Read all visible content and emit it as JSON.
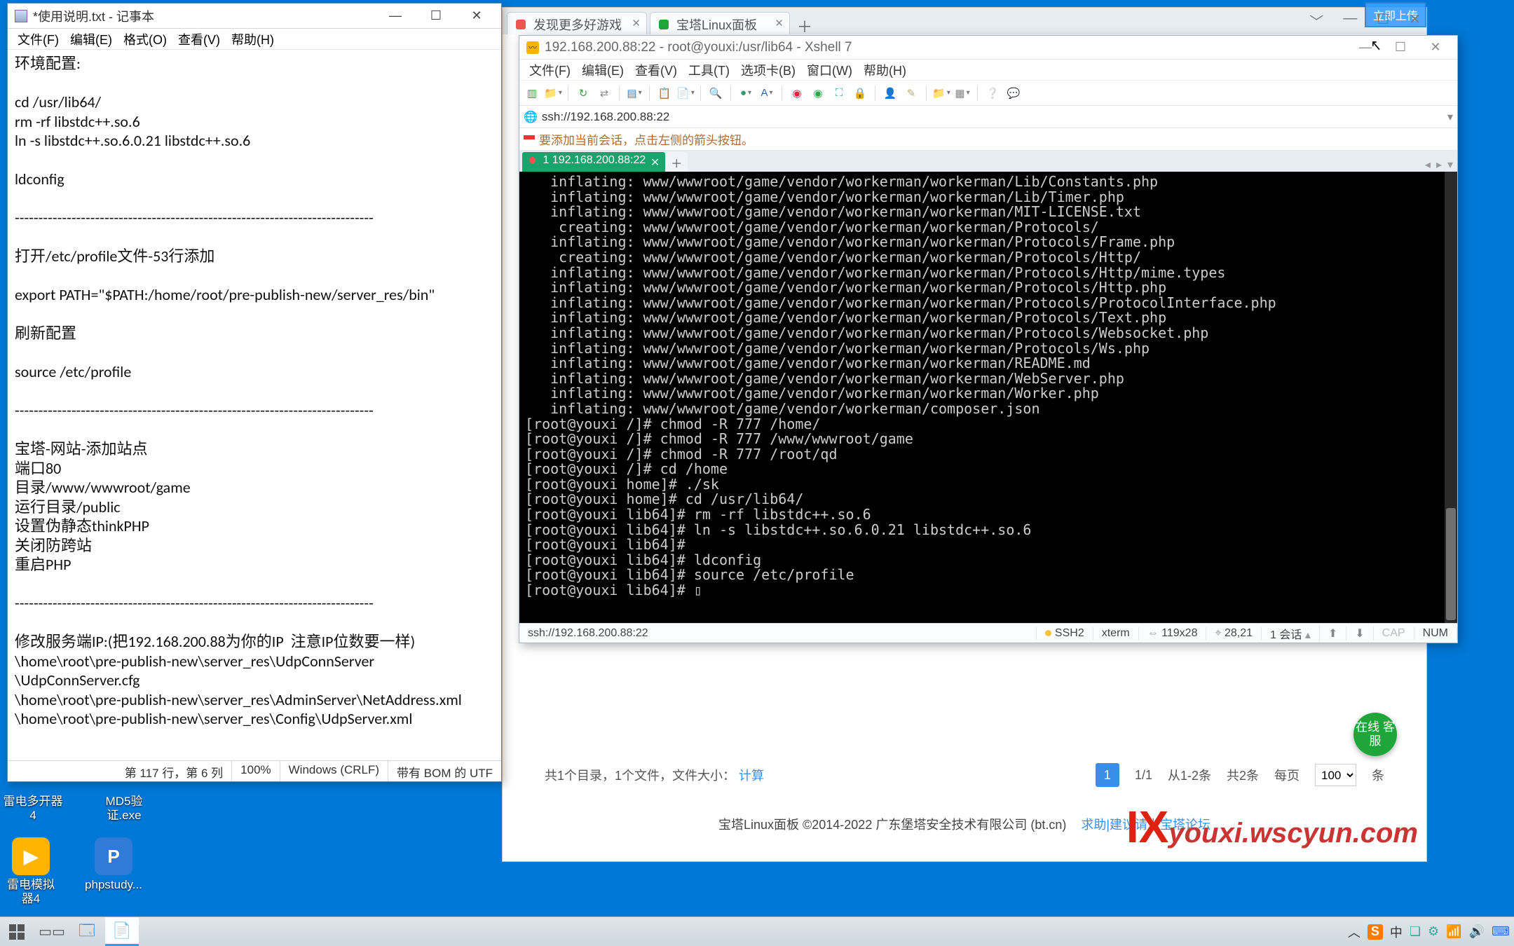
{
  "notepad": {
    "title": "*使用说明.txt - 记事本",
    "menu": [
      "文件(F)",
      "编辑(E)",
      "格式(O)",
      "查看(V)",
      "帮助(H)"
    ],
    "body": "环境配置:\n\ncd /usr/lib64/\nrm -rf libstdc++.so.6\nln -s libstdc++.so.6.0.21 libstdc++.so.6\n\nldconfig\n\n----------------------------------------------------------------------------\n\n打开/etc/profile文件-53行添加\n\nexport PATH=\"$PATH:/home/root/pre-publish-new/server_res/bin\"\n\n刷新配置\n\nsource /etc/profile\n\n----------------------------------------------------------------------------\n\n宝塔-网站-添加站点\n端口80\n目录/www/wwwroot/game\n运行目录/public\n设置伪静态thinkPHP\n关闭防跨站\n重启PHP\n\n----------------------------------------------------------------------------\n\n修改服务端IP:(把192.168.200.88为你的IP  注意IP位数要一样)\n\\home\\root\\pre-publish-new\\server_res\\UdpConnServer\n\\UdpConnServer.cfg\n\\home\\root\\pre-publish-new\\server_res\\AdminServer\\NetAddress.xml\n\\home\\root\\pre-publish-new\\server_res\\Config\\UdpServer.xml",
    "status": {
      "pos": "第 117 行，第 6 列",
      "zoom": "100%",
      "eol": "Windows (CRLF)",
      "enc": "带有 BOM 的 UTF"
    }
  },
  "browser": {
    "tabs": [
      {
        "label": "发现更多好游戏",
        "favcolor": "#e55",
        "closable": true,
        "trunc": true
      },
      {
        "label": "宝塔Linux面板",
        "favcolor": "#20a53a",
        "closable": true
      }
    ],
    "winbtns": [
      "﹀",
      "—",
      "☐",
      "✕"
    ],
    "pager": {
      "summary_a": "共1个目录，1个文件，文件大小：",
      "calc": "计算",
      "page": "1",
      "of": "1/1",
      "range": "从1-2条",
      "total": "共2条",
      "perpage_label": "每页",
      "perpage_value": "100",
      "unit": "条"
    },
    "online": "在线\n客服",
    "footer": {
      "text": "宝塔Linux面板 ©2014-2022 广东堡塔安全技术有限公司 (bt.cn)",
      "link": "求助|建议请上宝塔论坛"
    },
    "upload": "立即上传",
    "watermark": {
      "red": "IX",
      "txt": "youxi.wscyun.com"
    }
  },
  "xshell": {
    "title": "192.168.200.88:22 - root@youxi:/usr/lib64 - Xshell 7",
    "menu": [
      "文件(F)",
      "编辑(E)",
      "查看(V)",
      "工具(T)",
      "选项卡(B)",
      "窗口(W)",
      "帮助(H)"
    ],
    "address": "ssh://192.168.200.88:22",
    "tip": "要添加当前会话，点击左侧的箭头按钮。",
    "tab": "1 192.168.200.88:22",
    "term": "   inflating: www/wwwroot/game/vendor/workerman/workerman/Lib/Constants.php\n   inflating: www/wwwroot/game/vendor/workerman/workerman/Lib/Timer.php\n   inflating: www/wwwroot/game/vendor/workerman/workerman/MIT-LICENSE.txt\n    creating: www/wwwroot/game/vendor/workerman/workerman/Protocols/\n   inflating: www/wwwroot/game/vendor/workerman/workerman/Protocols/Frame.php\n    creating: www/wwwroot/game/vendor/workerman/workerman/Protocols/Http/\n   inflating: www/wwwroot/game/vendor/workerman/workerman/Protocols/Http/mime.types\n   inflating: www/wwwroot/game/vendor/workerman/workerman/Protocols/Http.php\n   inflating: www/wwwroot/game/vendor/workerman/workerman/Protocols/ProtocolInterface.php\n   inflating: www/wwwroot/game/vendor/workerman/workerman/Protocols/Text.php\n   inflating: www/wwwroot/game/vendor/workerman/workerman/Protocols/Websocket.php\n   inflating: www/wwwroot/game/vendor/workerman/workerman/Protocols/Ws.php\n   inflating: www/wwwroot/game/vendor/workerman/workerman/README.md\n   inflating: www/wwwroot/game/vendor/workerman/workerman/WebServer.php\n   inflating: www/wwwroot/game/vendor/workerman/workerman/Worker.php\n   inflating: www/wwwroot/game/vendor/workerman/composer.json\n[root@youxi /]# chmod -R 777 /home/\n[root@youxi /]# chmod -R 777 /www/wwwroot/game\n[root@youxi /]# chmod -R 777 /root/qd\n[root@youxi /]# cd /home\n[root@youxi home]# ./sk\n[root@youxi home]# cd /usr/lib64/\n[root@youxi lib64]# rm -rf libstdc++.so.6\n[root@youxi lib64]# ln -s libstdc++.so.6.0.21 libstdc++.so.6\n[root@youxi lib64]# \n[root@youxi lib64]# ldconfig\n[root@youxi lib64]# source /etc/profile\n[root@youxi lib64]# ▯",
    "status": {
      "addr": "ssh://192.168.200.88:22",
      "proto": "SSH2",
      "term": "xterm",
      "size": "119x28",
      "cursor": "28,21",
      "sess": "1 会话",
      "caps": "CAP",
      "num": "NUM"
    }
  },
  "desktop": {
    "icons_top": [
      {
        "label": "雷电多开器4",
        "color": "#444"
      },
      {
        "label": "MD5验证.exe",
        "color": "#3b6"
      }
    ],
    "icons_mid": [
      {
        "label": "雷电模拟器4",
        "color": "#ffb400",
        "letter": "▶"
      },
      {
        "label": "phpstudy...",
        "color": "#2f7bd6",
        "letter": "P"
      }
    ]
  },
  "taskbar": {
    "tray": [
      "中",
      "❏",
      "⚙",
      "📶",
      "🔊",
      "⌨"
    ],
    "sogou": "S"
  }
}
